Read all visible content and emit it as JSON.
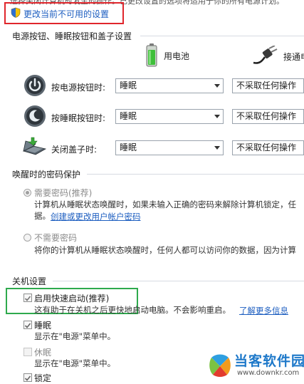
{
  "top_cut_text": "选择关闭计算机时发生的操作。已更改设置的选项将适用于你的所有电源计划。",
  "change_settings_link": "更改当前不可用的设置",
  "power_section": {
    "title": "电源按钮、睡眠按钮和盖子设置",
    "columns": [
      "用电池",
      "接通电源"
    ],
    "rows": [
      {
        "label": "按电源按钮时:",
        "battery": "睡眠",
        "plugged": "不采取任何操作"
      },
      {
        "label": "按睡眠按钮时:",
        "battery": "睡眠",
        "plugged": "不采取任何操作"
      },
      {
        "label": "关闭盖子时:",
        "battery": "睡眠",
        "plugged": "不采取任何操作"
      }
    ]
  },
  "password_section": {
    "title": "唤醒时的密码保护",
    "require": {
      "label": "需要密码(推荐)",
      "desc1": "计算机从睡眠状态唤醒时，如果未输入正确的密码来解除计算机锁定，任",
      "desc2": "据。",
      "link": "创建或更改用户帐户密码"
    },
    "no_require": {
      "label": "不需要密码",
      "desc1": "将你的计算机从睡眠状态唤醒时，任何人都可以访问你的数据，因为计算"
    }
  },
  "shutdown_section": {
    "title": "关机设置",
    "fast_startup": {
      "label": "启用快速启动(推荐)",
      "desc": "这有助于在关机之后更快地启动电脑。不会影响重启。",
      "link": "了解更多信息",
      "checked": true
    },
    "sleep": {
      "label": "睡眠",
      "desc": "显示在\"电源\"菜单中。",
      "checked": true
    },
    "hibernate": {
      "label": "休眠",
      "desc": "显示在\"电源\"菜单中。",
      "checked": false
    },
    "lock": {
      "label": "锁定",
      "checked": true
    }
  },
  "watermark": {
    "name": "当客软件园",
    "url": "www.downkr.com"
  },
  "colors": {
    "highlight_red": "#e0262c",
    "highlight_green": "#2eaa4d",
    "link": "#1d5ec0",
    "watermark_blue": "#1d78c9"
  }
}
